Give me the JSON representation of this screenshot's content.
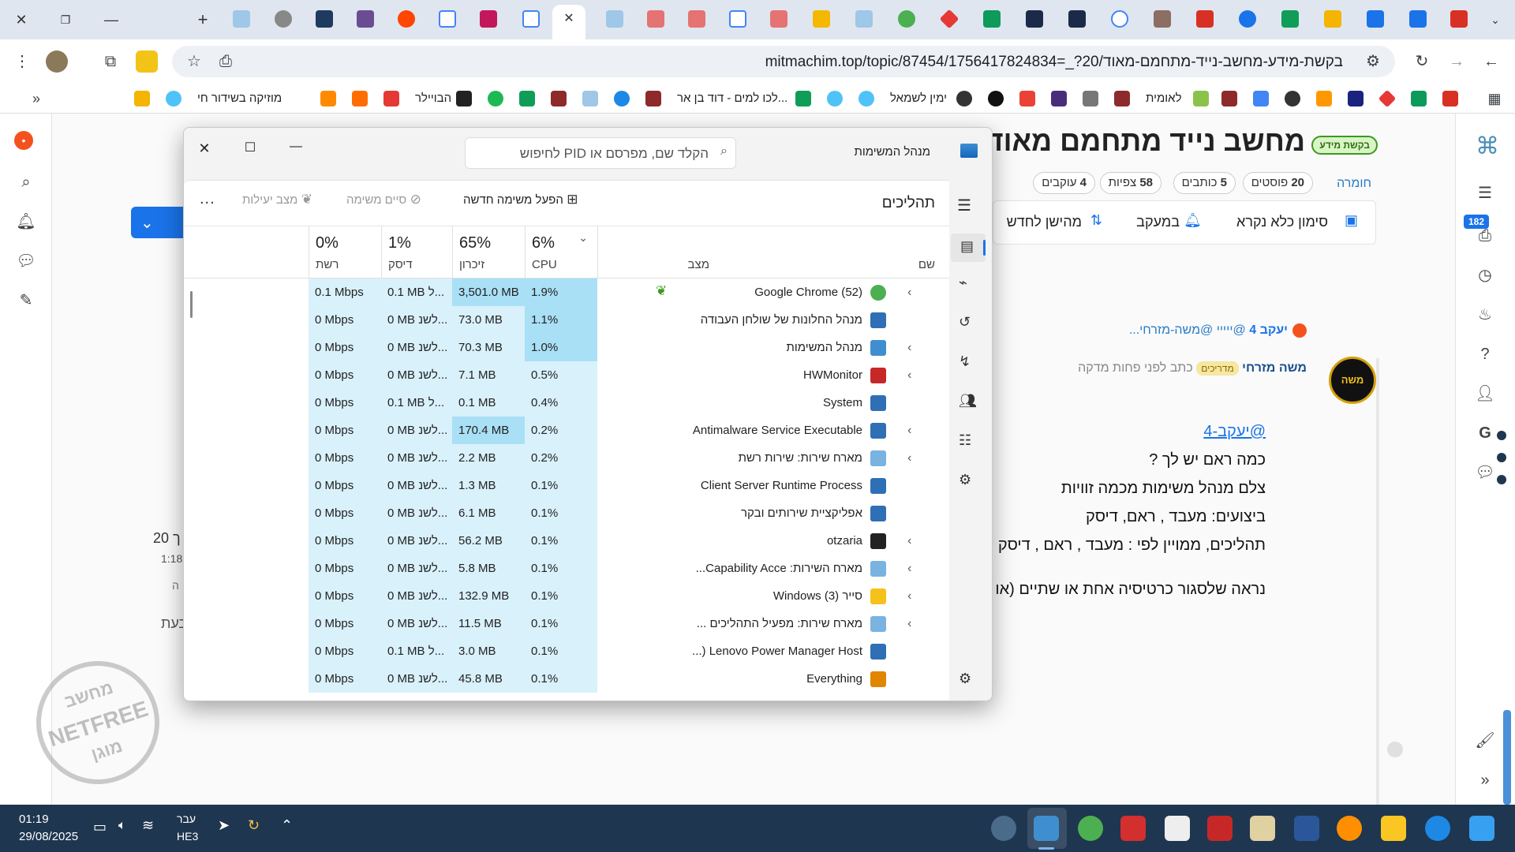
{
  "browser": {
    "url": "mitmachim.top/topic/87454/1756417824834=_?20/בקשת-מידע-מחשב-נייד-מתחמם-מאוד",
    "bookmarks": [
      "מוזיקה בשידור חי",
      "הבויילר",
      "לכו למים - דוד בן אר...",
      "ימין לשמאל",
      "לאומית"
    ]
  },
  "forum": {
    "badge": "בקשת מידע",
    "title": "מחשב נייד מתחמם מאוד",
    "category": "חומרה",
    "stats": [
      {
        "num": "20",
        "label": "פוסטים"
      },
      {
        "num": "5",
        "label": "כותבים"
      },
      {
        "num": "58",
        "label": "צפיות"
      },
      {
        "num": "4",
        "label": "עוקבים"
      }
    ],
    "actions": [
      "סימון כלא נקרא",
      "במעקב",
      "מהישן לחדש"
    ],
    "notif_count": "182",
    "reply_to": "יעקב 4",
    "reply_snippet": "@ייייי @משה-מזרחי...",
    "author": "משה מזרחי",
    "author_role": "מדריכים",
    "posted": "כתב לפני פחות מדקה",
    "mention": "@יעקב-4",
    "lines": [
      "כמה ראם יש לך ?",
      "צלם מנהל משימות מכמה זוויות",
      "ביצועים: מעבד , ראם, דיסק",
      "תהליכים, ממויין לפי : מעבד , ראם , דיסק",
      "נראה שלסגור כרטיסיה אחת או שתיים (או עי"
    ],
    "left_snip": [
      "ך 20",
      "1:18",
      "ה",
      "בעת"
    ],
    "watermark": [
      "מחשב",
      "NETFREE",
      "מוגן"
    ]
  },
  "taskmgr": {
    "title": "מנהל המשימות",
    "search_placeholder": "הקלד שם, מפרסם או PID לחיפוש",
    "section": "תהליכים",
    "cmd_new": "הפעל משימה חדשה",
    "cmd_end": "סיים משימה",
    "cmd_eff": "מצב יעילות",
    "cmd_more": "...",
    "col_name": "שם",
    "col_status": "מצב",
    "cols": [
      {
        "pct": "6%",
        "label": "CPU"
      },
      {
        "pct": "65%",
        "label": "זיכרון"
      },
      {
        "pct": "1%",
        "label": "דיסק"
      },
      {
        "pct": "0%",
        "label": "רשת"
      }
    ],
    "rows": [
      {
        "name": "(52) Google Chrome",
        "cpu": "1.9%",
        "mem": "3,501.0 MB",
        "disk": "0.1 MB ל...",
        "net": "0.1 Mbps",
        "exp": true
      },
      {
        "name": "מנהל החלונות של שולחן העבודה",
        "cpu": "1.1%",
        "mem": "73.0 MB",
        "disk": "0 MB לשנ...",
        "net": "0 Mbps",
        "exp": false
      },
      {
        "name": "מנהל המשימות",
        "cpu": "1.0%",
        "mem": "70.3 MB",
        "disk": "0 MB לשנ...",
        "net": "0 Mbps",
        "exp": true
      },
      {
        "name": "HWMonitor",
        "cpu": "0.5%",
        "mem": "7.1 MB",
        "disk": "0 MB לשנ...",
        "net": "0 Mbps",
        "exp": true
      },
      {
        "name": "System",
        "cpu": "0.4%",
        "mem": "0.1 MB",
        "disk": "0.1 MB ל...",
        "net": "0 Mbps",
        "exp": false
      },
      {
        "name": "Antimalware Service Executable",
        "cpu": "0.2%",
        "mem": "170.4 MB",
        "disk": "0 MB לשנ...",
        "net": "0 Mbps",
        "exp": true
      },
      {
        "name": "מארח שירות: שירות רשת",
        "cpu": "0.2%",
        "mem": "2.2 MB",
        "disk": "0 MB לשנ...",
        "net": "0 Mbps",
        "exp": true
      },
      {
        "name": "Client Server Runtime Process",
        "cpu": "0.1%",
        "mem": "1.3 MB",
        "disk": "0 MB לשנ...",
        "net": "0 Mbps",
        "exp": false
      },
      {
        "name": "אפליקציית שירותים ובקר",
        "cpu": "0.1%",
        "mem": "6.1 MB",
        "disk": "0 MB לשנ...",
        "net": "0 Mbps",
        "exp": false
      },
      {
        "name": "otzaria",
        "cpu": "0.1%",
        "mem": "56.2 MB",
        "disk": "0 MB לשנ...",
        "net": "0 Mbps",
        "exp": true
      },
      {
        "name": "מארח השירות: Capability Acce...",
        "cpu": "0.1%",
        "mem": "5.8 MB",
        "disk": "0 MB לשנ...",
        "net": "0 Mbps",
        "exp": true
      },
      {
        "name": "סייר Windows (3)",
        "cpu": "0.1%",
        "mem": "132.9 MB",
        "disk": "0 MB לשנ...",
        "net": "0 Mbps",
        "exp": true
      },
      {
        "name": "מארח שירות: מפעיל התהליכים ...",
        "cpu": "0.1%",
        "mem": "11.5 MB",
        "disk": "0 MB לשנ...",
        "net": "0 Mbps",
        "exp": true
      },
      {
        "name": "Lenovo Power Manager Host (...",
        "cpu": "0.1%",
        "mem": "3.0 MB",
        "disk": "0.1 MB ל...",
        "net": "0 Mbps",
        "exp": false
      },
      {
        "name": "Everything",
        "cpu": "0.1%",
        "mem": "45.8 MB",
        "disk": "0 MB לשנ...",
        "net": "0 Mbps",
        "exp": false
      }
    ]
  },
  "taskbar": {
    "time": "01:19",
    "date": "29/08/2025",
    "lang": "עבר",
    "kbd": "HE3"
  }
}
